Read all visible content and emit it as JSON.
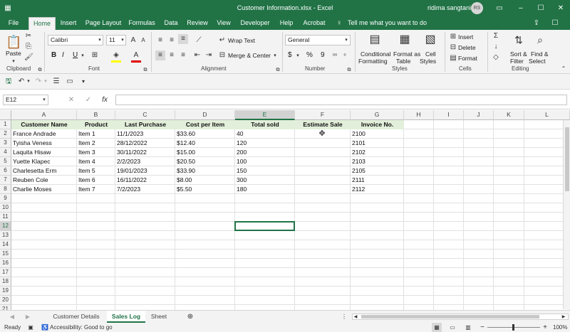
{
  "titlebar": {
    "title": "Customer Information.xlsx  -  Excel",
    "user": "ridima sangtani",
    "avatar": "RS"
  },
  "tabs": [
    "File",
    "Home",
    "Insert",
    "Page Layout",
    "Formulas",
    "Data",
    "Review",
    "View",
    "Developer",
    "Help",
    "Acrobat"
  ],
  "tell_me": "Tell me what you want to do",
  "ribbon": {
    "clipboard": {
      "paste": "Paste",
      "label": "Clipboard"
    },
    "font": {
      "name": "Calibri",
      "size": "11",
      "label": "Font",
      "bold": "B",
      "italic": "I",
      "underline": "U"
    },
    "alignment": {
      "wrap": "Wrap Text",
      "merge": "Merge & Center",
      "label": "Alignment"
    },
    "number": {
      "format": "General",
      "label": "Number",
      "currency": "$",
      "percent": "%",
      "comma": "9"
    },
    "styles": {
      "cond": "Conditional",
      "cond2": "Formatting",
      "fmt_table": "Format as",
      "fmt_table2": "Table",
      "cell": "Cell",
      "cell2": "Styles",
      "label": "Styles"
    },
    "cells": {
      "insert": "Insert",
      "delete": "Delete",
      "format": "Format",
      "label": "Cells"
    },
    "editing": {
      "sort": "Sort &",
      "sort2": "Filter",
      "find": "Find &",
      "find2": "Select",
      "label": "Editing"
    }
  },
  "formula_bar": {
    "name_box": "E12",
    "fx": "fx",
    "value": ""
  },
  "columns": [
    "A",
    "B",
    "C",
    "D",
    "E",
    "F",
    "G",
    "H",
    "I",
    "J",
    "K",
    "L"
  ],
  "rows": [
    "1",
    "2",
    "3",
    "4",
    "5",
    "6",
    "7",
    "8",
    "9",
    "10",
    "11",
    "12",
    "13",
    "14",
    "15",
    "16",
    "17",
    "18",
    "19",
    "20",
    "21"
  ],
  "headers": [
    "Customer Name",
    "Product",
    "Last Purchase",
    "Cost per Item",
    "Total sold",
    "Estimate Sale",
    "Invoice No."
  ],
  "table": [
    [
      "France Andrade",
      "Item 1",
      "11/1/2023",
      "$33.60",
      "40",
      "",
      "2100"
    ],
    [
      "Tyisha Veness",
      "Item 2",
      "28/12/2022",
      "$12.40",
      "120",
      "",
      "2101"
    ],
    [
      "Laquita Hisaw",
      "Item 3",
      "30/11/2022",
      "$15.00",
      "200",
      "",
      "2102"
    ],
    [
      "Yuette Klapec",
      "Item 4",
      "2/2/2023",
      "$20.50",
      "100",
      "",
      "2103"
    ],
    [
      "Charlesetta Erm",
      "Item 5",
      "19/01/2023",
      "$33.90",
      "150",
      "",
      "2105"
    ],
    [
      "Reuben Cole",
      "Item 6",
      "16/11/2022",
      "$8.00",
      "300",
      "",
      "2111"
    ],
    [
      "Charlie Moses",
      "Item 7",
      "7/2/2023",
      "$5.50",
      "180",
      "",
      "2112"
    ]
  ],
  "sheets": [
    "Customer Details",
    "Sales Log",
    "Sheet"
  ],
  "active_sheet": "Sales Log",
  "status": {
    "ready": "Ready",
    "accessibility": "Accessibility: Good to go",
    "zoom": "100%"
  },
  "colors": {
    "excel_green": "#217346",
    "header_fill": "#e2efda"
  }
}
